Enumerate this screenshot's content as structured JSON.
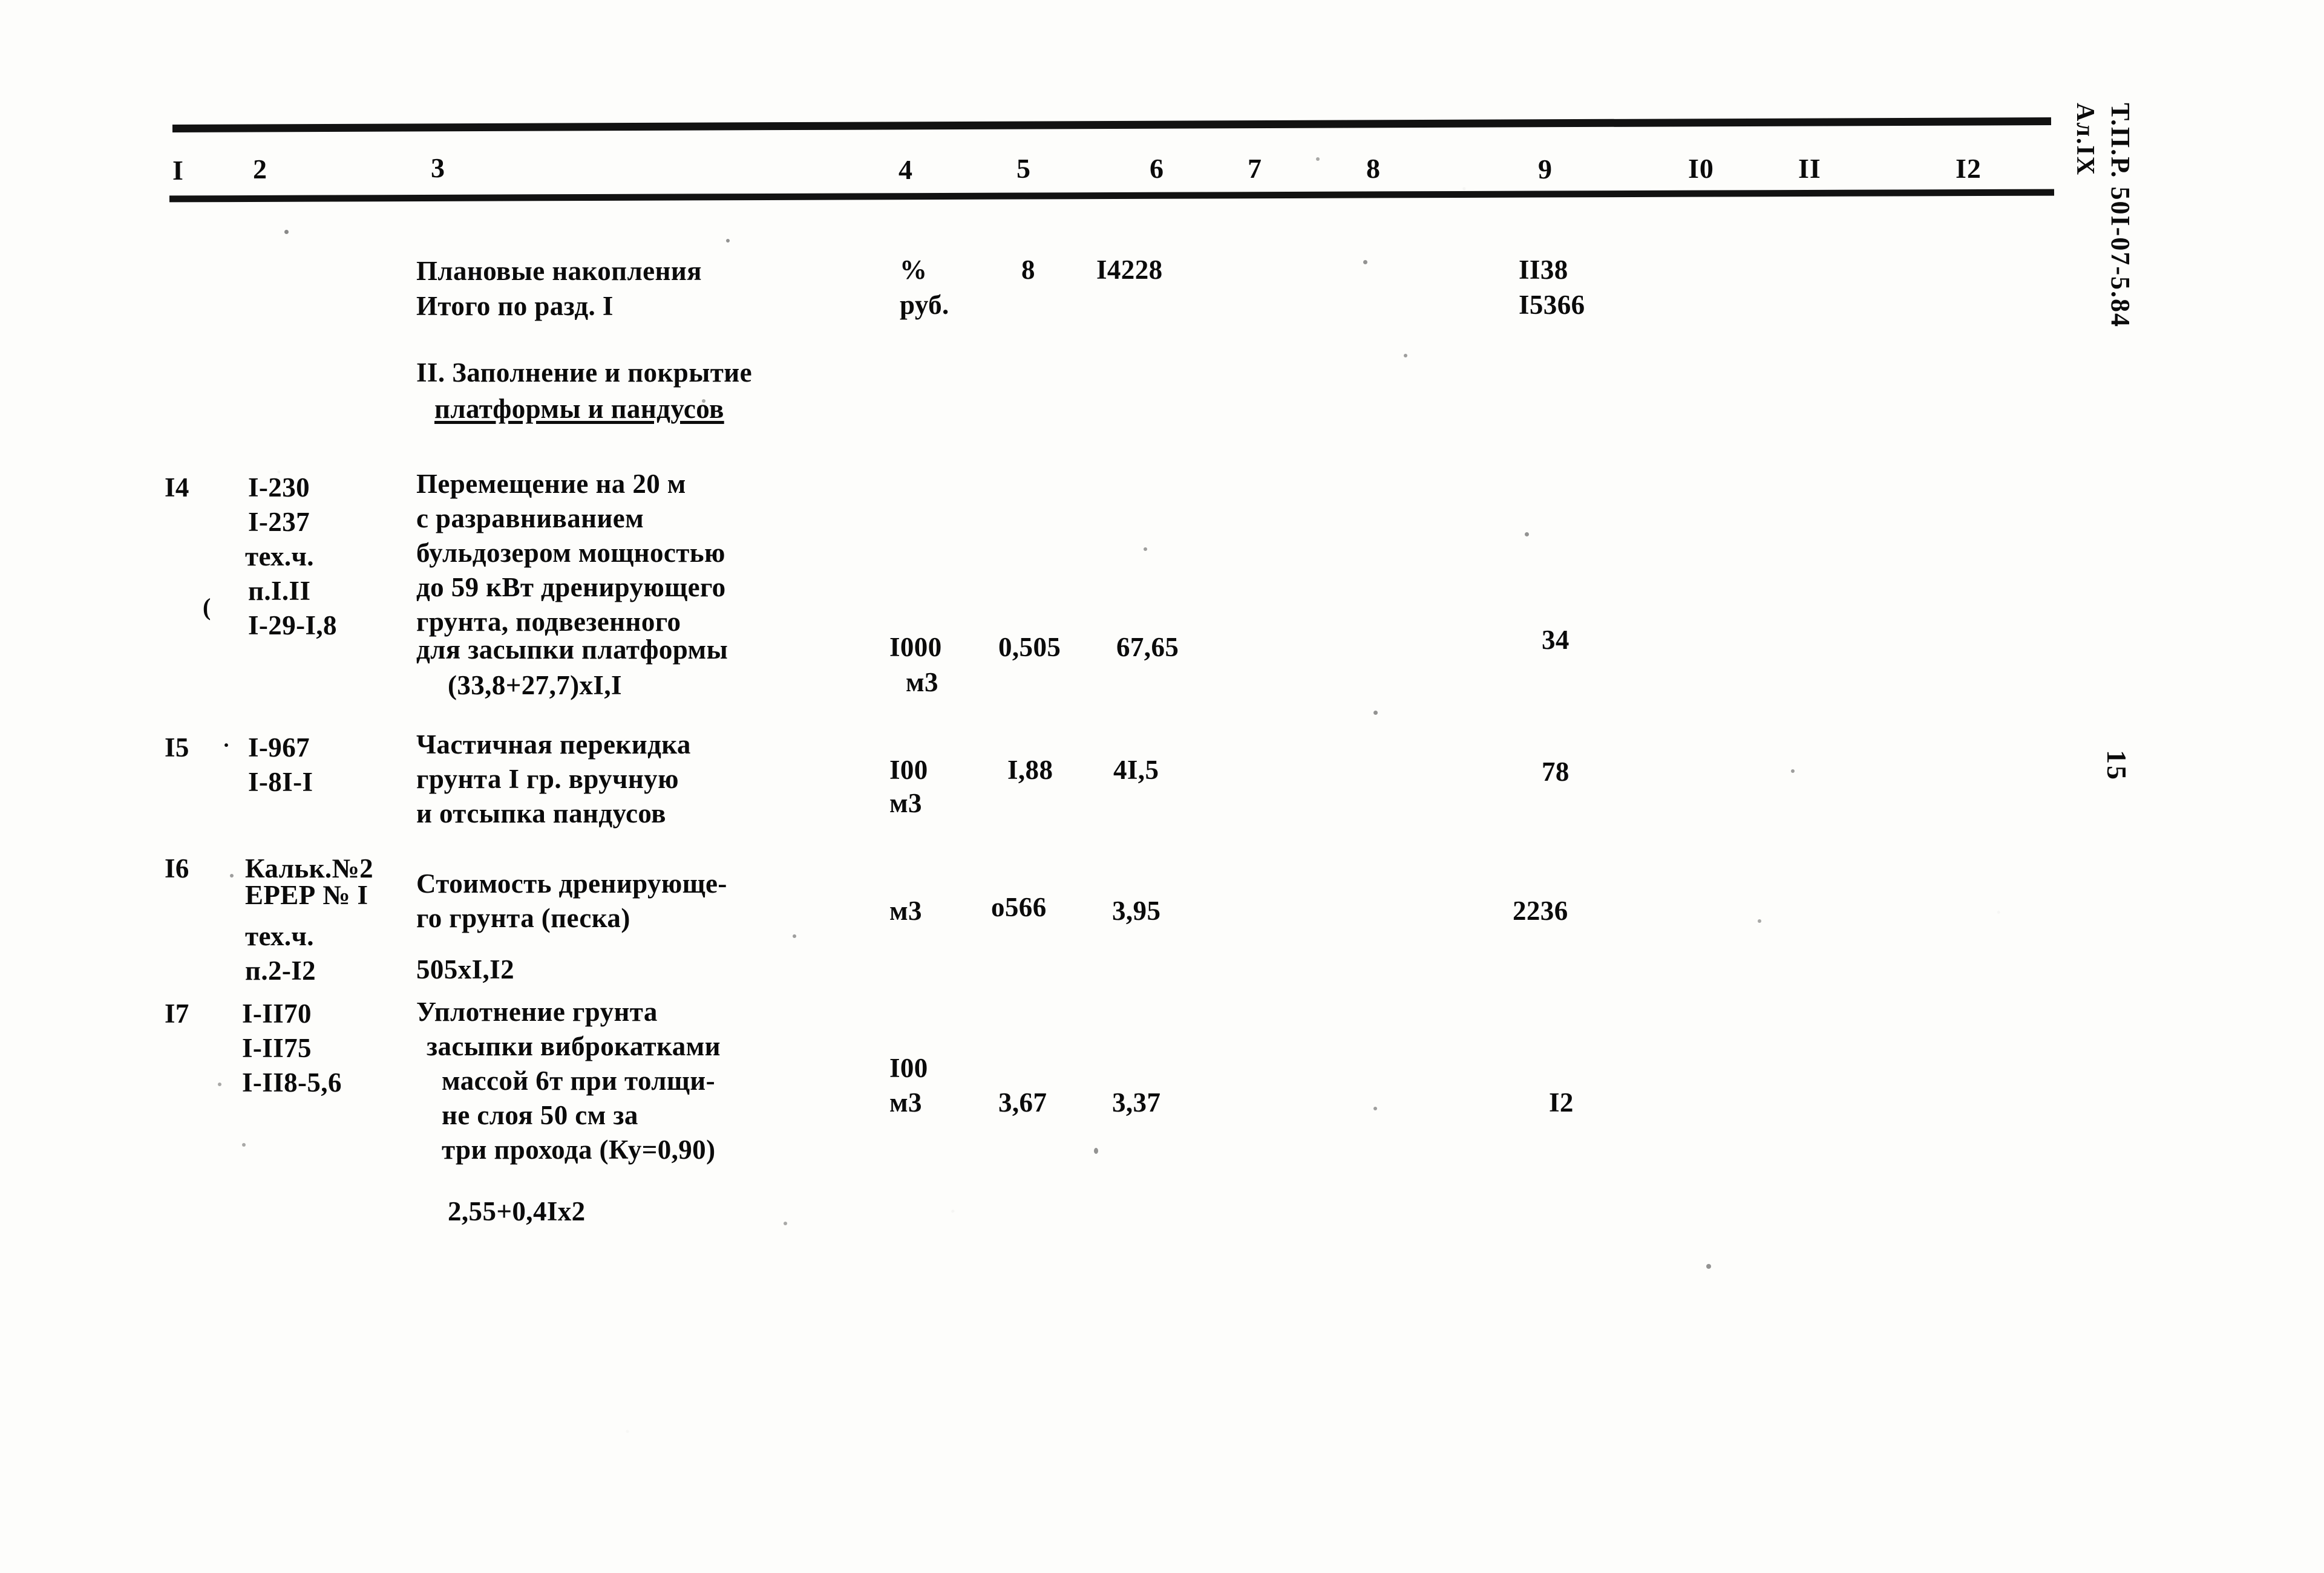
{
  "document": {
    "margin_code": "Т.П.Р. 50I-07-5.84",
    "margin_album": "Ал.IX",
    "page_number": "15"
  },
  "table": {
    "column_headers": [
      "I",
      "2",
      "3",
      "4",
      "5",
      "6",
      "7",
      "8",
      "9",
      "I0",
      "II",
      "I2"
    ],
    "summary_rows": [
      {
        "name": "Плановые накопления",
        "unit": "%",
        "col5": "8",
        "col6": "I4228",
        "col9": "II38"
      },
      {
        "name": "Итого по разд. I",
        "unit": "руб.",
        "col5": "",
        "col6": "",
        "col9": "I5366"
      }
    ],
    "section_heading": {
      "line1": "II. Заполнение и покрытие",
      "line2": "платформы и пандусов"
    },
    "rows": [
      {
        "no": "I4",
        "codes": [
          "I-230",
          "I-237",
          "тех.ч.",
          "п.I.II",
          "I-29-I,8"
        ],
        "paren": "(",
        "description": [
          "Перемещение на 20 м",
          "с разравниванием",
          "бульдозером мощностью",
          "до 59 кВт дренирующего",
          "грунта, подвезенного",
          "для засыпки платформы"
        ],
        "formula": "(33,8+27,7)xI,I",
        "unit_top": "I000",
        "unit_bottom": "м3",
        "col5": "0,505",
        "col6": "67,65",
        "col9": "34"
      },
      {
        "no": "I5",
        "marker": "·",
        "codes": [
          "I-967",
          "I-8I-I"
        ],
        "description": [
          "Частичная перекидка",
          "грунта I гр. вручную",
          "и отсыпка пандусов"
        ],
        "unit_top": "I00",
        "unit_bottom": "м3",
        "col5": "I,88",
        "col6": "4I,5",
        "col9": "78"
      },
      {
        "no": "I6",
        "codes": [
          "Кальк.№2",
          "ЕРЕР № I",
          "тех.ч.",
          "п.2-I2"
        ],
        "description": [
          "Стоимость дренирующе-",
          "го грунта (песка)"
        ],
        "formula": "505xI,I2",
        "unit_top": "м3",
        "unit_bottom": "",
        "col5": "о566",
        "col6": "3,95",
        "col9": "2236"
      },
      {
        "no": "I7",
        "codes": [
          "I-II70",
          "I-II75",
          "I-II8-5,6"
        ],
        "description": [
          "Уплотнение грунта",
          "засыпки виброкатками",
          "массой 6т при толщи-",
          "не слоя 50 см за",
          "три прохода (Ку=0,90)"
        ],
        "formula": "2,55+0,4Ix2",
        "unit_top": "I00",
        "unit_bottom": "м3",
        "col5": "3,67",
        "col6": "3,37",
        "col9": "I2"
      }
    ]
  }
}
